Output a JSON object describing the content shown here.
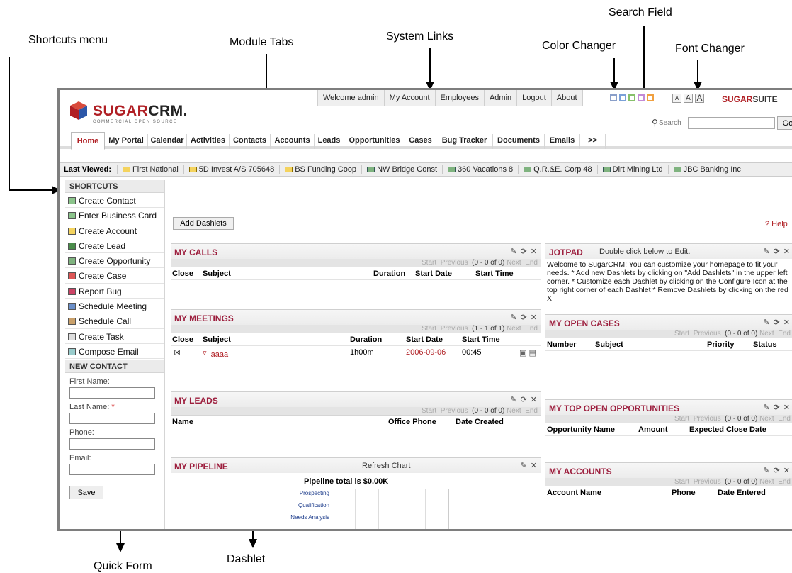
{
  "annotations": {
    "shortcuts_menu": "Shortcuts menu",
    "module_tabs": "Module Tabs",
    "system_links": "System Links",
    "search_field": "Search Field",
    "color_changer": "Color Changer",
    "font_changer": "Font Changer",
    "quick_form": "Quick Form",
    "dashlet": "Dashlet"
  },
  "header": {
    "logo_name_1": "SUGAR",
    "logo_name_2": "CRM.",
    "logo_tagline": "COMMERCIAL OPEN SOURCE",
    "system_links": [
      "Welcome admin",
      "My Account",
      "Employees",
      "Admin",
      "Logout",
      "About"
    ],
    "color_swatches": [
      "#8a9fc9",
      "#7aa0d8",
      "#87c06b",
      "#c38ad6",
      "#f0a040"
    ],
    "font_buttons": [
      "A",
      "A",
      "A"
    ],
    "suite_1": "SUGAR",
    "suite_2": "SUITE",
    "search_label": "Search",
    "search_button": "Go"
  },
  "tabs": [
    "Home",
    "My Portal",
    "Calendar",
    "Activities",
    "Contacts",
    "Accounts",
    "Leads",
    "Opportunities",
    "Cases",
    "Bug Tracker",
    "Documents",
    "Emails",
    ">>"
  ],
  "last_viewed": {
    "label": "Last Viewed:",
    "items": [
      "First National",
      "5D Invest A/S 705648",
      "BS Funding Coop",
      "NW Bridge Const",
      "360 Vacations 8",
      "Q.R.&E. Corp 48",
      "Dirt Mining Ltd",
      "JBC Banking Inc"
    ]
  },
  "shortcuts": {
    "heading": "SHORTCUTS",
    "items": [
      "Create Contact",
      "Enter Business Card",
      "Create Account",
      "Create Lead",
      "Create Opportunity",
      "Create Case",
      "Report Bug",
      "Schedule Meeting",
      "Schedule Call",
      "Create Task",
      "Compose Email"
    ]
  },
  "new_contact": {
    "heading": "NEW CONTACT",
    "first_name": "First Name:",
    "last_name": "Last Name:",
    "required": "*",
    "phone": "Phone:",
    "email": "Email:",
    "save": "Save"
  },
  "main": {
    "add_dashlets": "Add Dashlets",
    "help": "? Help"
  },
  "nav": {
    "start": "Start",
    "previous": "Previous",
    "next": "Next",
    "end": "End"
  },
  "my_calls": {
    "title": "MY CALLS",
    "count": "(0 - 0 of 0)",
    "cols": [
      "Close",
      "Subject",
      "Duration",
      "Start Date",
      "Start Time"
    ]
  },
  "my_meetings": {
    "title": "MY MEETINGS",
    "count": "(1 - 1 of 1)",
    "cols": [
      "Close",
      "Subject",
      "Duration",
      "Start Date",
      "Start Time"
    ],
    "row": {
      "subject": "aaaa",
      "duration": "1h00m",
      "start_date": "2006-09-06",
      "start_time": "00:45"
    }
  },
  "my_leads": {
    "title": "MY LEADS",
    "count": "(0 - 0 of 0)",
    "cols": [
      "Name",
      "Office Phone",
      "Date Created"
    ]
  },
  "my_pipeline": {
    "title": "MY PIPELINE",
    "refresh": "Refresh Chart",
    "total": "Pipeline total is $0.00K",
    "categories": [
      "Prospecting",
      "Qualification",
      "Needs Analysis"
    ]
  },
  "jotpad": {
    "title": "JOTPAD",
    "subtitle": "Double click below to Edit.",
    "body": "Welcome to SugarCRM! You can customize your homepage to fit your needs. * Add new Dashlets by clicking on \"Add Dashlets\" in the upper left corner. * Customize each Dashlet by clicking on the Configure Icon at the top right corner of each Dashlet * Remove Dashlets by clicking on the red X"
  },
  "my_open_cases": {
    "title": "MY OPEN CASES",
    "count": "(0 - 0 of 0)",
    "cols": [
      "Number",
      "Subject",
      "Priority",
      "Status"
    ]
  },
  "my_top_opps": {
    "title": "MY TOP OPEN OPPORTUNITIES",
    "count": "(0 - 0 of 0)",
    "cols": [
      "Opportunity Name",
      "Amount",
      "Expected Close Date"
    ]
  },
  "my_accounts": {
    "title": "MY ACCOUNTS",
    "count": "(0 - 0 of 0)",
    "cols": [
      "Account Name",
      "Phone",
      "Date Entered"
    ]
  }
}
